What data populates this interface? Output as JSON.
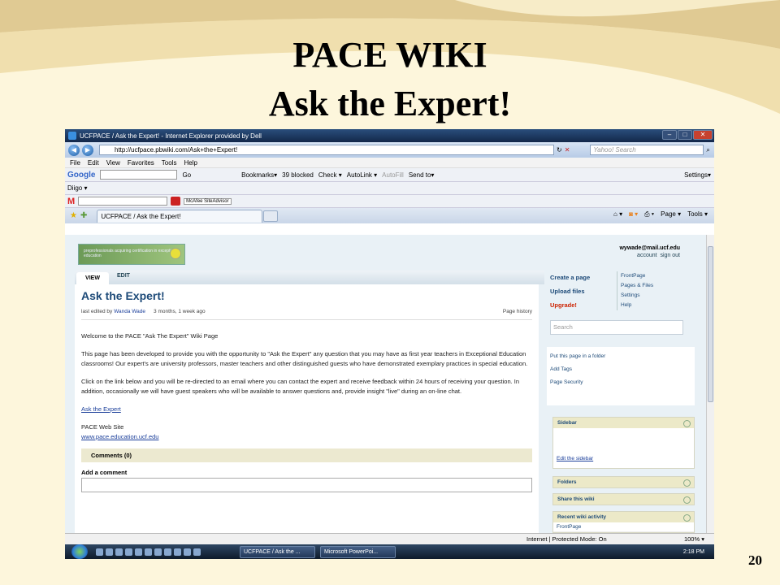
{
  "slide": {
    "title_line1": "PACE WIKI",
    "title_line2": "Ask the Expert!",
    "slide_number": "20"
  },
  "browser": {
    "window_title": "UCFPACE / Ask the Expert! - Internet Explorer provided by Dell",
    "address": "http://ucfpace.pbwiki.com/Ask+the+Expert!",
    "search_placeholder": "Yahoo! Search",
    "menu": [
      "File",
      "Edit",
      "View",
      "Favorites",
      "Tools",
      "Help"
    ],
    "google_toolbar": {
      "logo": "Google",
      "go": "Go",
      "bookmarks": "Bookmarks▾",
      "blocked": "39 blocked",
      "check": "Check ▾",
      "autolink": "AutoLink ▾",
      "autofill": "AutoFill",
      "sendto": "Send to▾",
      "settings": "Settings▾"
    },
    "diigo": "Diigo ▾",
    "mcafee": "McAfee SiteAdvisor",
    "tab_label": "UCFPACE / Ask the Expert!",
    "command_bar": [
      "Page ▾",
      "Tools ▾"
    ]
  },
  "wiki": {
    "logo_text": "preprofessionals acquiring certification in exceptional education",
    "user_email": "wywade@mail.ucf.edu",
    "account_link": "account",
    "signout_link": "sign out",
    "tab_view": "VIEW",
    "tab_edit": "EDIT",
    "page_title": "Ask the Expert!",
    "last_edited_label": "last edited by",
    "editor": "Wanda Wade",
    "edited_ago": "3 months, 1 week ago",
    "page_history": "Page history",
    "p1": "Welcome to the PACE \"Ask The Expert\" Wiki Page",
    "p2": "This page has been developed to provide you with the opportunity to \"Ask the Expert\" any question that you may have as first year teachers in Exceptional Education classrooms! Our expert's are university professors, master teachers and other distinguished guests who have demonstrated exemplary practices in special education.",
    "p3": "Click on the link below and you will be re-directed to an email where you can contact the expert and receive feedback within 24 hours of receiving your question. In addition, occasionally we will have guest speakers who will be available to answer questions and, provide insight \"live\" during an on-line chat.",
    "ask_link": "Ask the Expert",
    "site_label": "PACE Web Site",
    "site_link": "www.pace.education.ucf.edu",
    "comments": "Comments (0)",
    "add_comment": "Add a comment",
    "create_page": "Create a page",
    "upload_files": "Upload files",
    "upgrade": "Upgrade!",
    "quick_links": [
      "FrontPage",
      "Pages & Files",
      "Settings",
      "Help"
    ],
    "search_placeholder": "Search",
    "put_in_folder": "Put this page in a folder",
    "add_tags": "Add Tags",
    "page_security": "Page Security",
    "sidebar_title": "Sidebar",
    "edit_sidebar": "Edit the sidebar",
    "folders": "Folders",
    "share": "Share this wiki",
    "recent": "Recent wiki activity",
    "recent_item": "FrontPage"
  },
  "status": {
    "zone": "Internet | Protected Mode: On",
    "zoom": "100% ▾"
  },
  "taskbar": {
    "task1": "UCFPACE / Ask the ...",
    "task2": "Microsoft PowerPoi...",
    "time": "2:18 PM"
  }
}
